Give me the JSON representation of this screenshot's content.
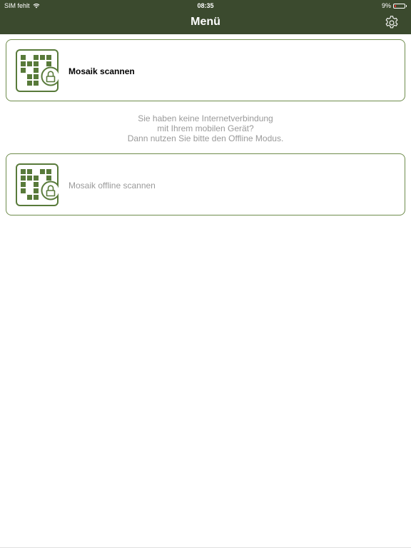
{
  "status_bar": {
    "carrier": "SIM fehlt",
    "time": "08:35",
    "battery": "9%",
    "wifi_icon": "wifi-icon",
    "battery_icon": "battery-icon"
  },
  "header": {
    "title": "Menü",
    "settings_icon": "gear-icon"
  },
  "colors": {
    "header_bg": "#3b4a2e",
    "accent": "#587a3a",
    "card_border": "#6f8c4c",
    "muted_text": "#9a9a9a"
  },
  "menu": {
    "scan": {
      "label": "Mosaik scannen",
      "icon": "mosaic-lock-icon"
    },
    "offline_message": [
      "Sie haben keine Internetverbindung",
      "mit Ihrem mobilen Gerät?",
      "Dann nutzen Sie bitte den Offline Modus."
    ],
    "offline_scan": {
      "label": "Mosaik offline scannen",
      "icon": "mosaic-lock-icon"
    }
  }
}
